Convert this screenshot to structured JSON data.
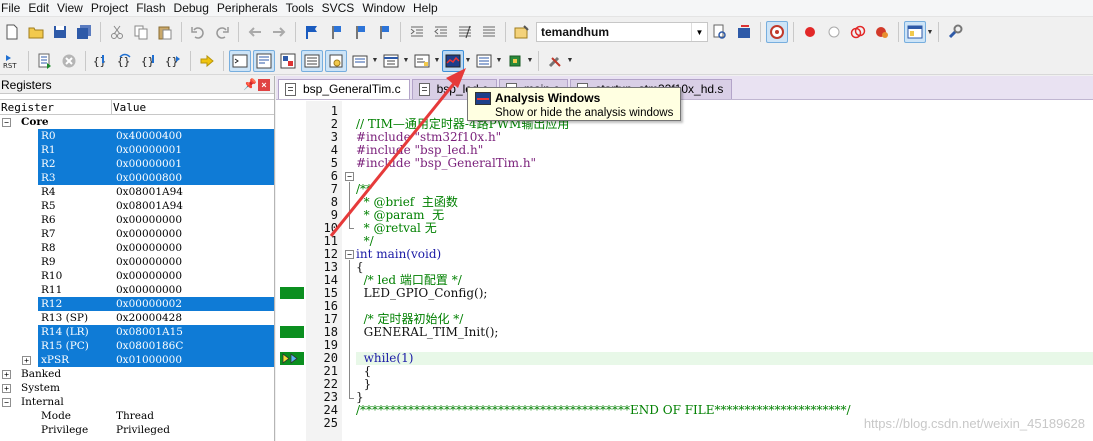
{
  "menu": [
    "File",
    "Edit",
    "View",
    "Project",
    "Flash",
    "Debug",
    "Peripherals",
    "Tools",
    "SVCS",
    "Window",
    "Help"
  ],
  "toolbar": {
    "target_name": "temandhum"
  },
  "registers": {
    "title": "Registers",
    "col_register": "Register",
    "col_value": "Value",
    "core_label": "Core",
    "rows": [
      {
        "name": "R0",
        "value": "0x40000400",
        "selected": true
      },
      {
        "name": "R1",
        "value": "0x00000001",
        "selected": true
      },
      {
        "name": "R2",
        "value": "0x00000001",
        "selected": true
      },
      {
        "name": "R3",
        "value": "0x00000800",
        "selected": true
      },
      {
        "name": "R4",
        "value": "0x08001A94",
        "selected": false
      },
      {
        "name": "R5",
        "value": "0x08001A94",
        "selected": false
      },
      {
        "name": "R6",
        "value": "0x00000000",
        "selected": false
      },
      {
        "name": "R7",
        "value": "0x00000000",
        "selected": false
      },
      {
        "name": "R8",
        "value": "0x00000000",
        "selected": false
      },
      {
        "name": "R9",
        "value": "0x00000000",
        "selected": false
      },
      {
        "name": "R10",
        "value": "0x00000000",
        "selected": false
      },
      {
        "name": "R11",
        "value": "0x00000000",
        "selected": false
      },
      {
        "name": "R12",
        "value": "0x00000002",
        "selected": true
      },
      {
        "name": "R13 (SP)",
        "value": "0x20000428",
        "selected": false
      },
      {
        "name": "R14 (LR)",
        "value": "0x08001A15",
        "selected": true
      },
      {
        "name": "R15 (PC)",
        "value": "0x0800186C",
        "selected": true
      },
      {
        "name": "xPSR",
        "value": "0x01000000",
        "selected": true
      }
    ],
    "groups": [
      "Banked",
      "System",
      "Internal"
    ],
    "internal_rows": [
      {
        "name": "Mode",
        "value": "Thread"
      },
      {
        "name": "Privilege",
        "value": "Privileged"
      }
    ]
  },
  "tabs": [
    {
      "label": "bsp_GeneralTim.c"
    },
    {
      "label": "bsp_led.c"
    },
    {
      "label": "main.c"
    },
    {
      "label": "startup_stm32f10x_hd.s"
    }
  ],
  "tooltip": {
    "title": "Analysis Windows",
    "desc": "Show or hide the analysis windows"
  },
  "code": {
    "line_numbers": [
      "1",
      "2",
      "3",
      "4",
      "5",
      "6",
      "7",
      "8",
      "9",
      "10",
      "11",
      "12",
      "13",
      "14",
      "15",
      "16",
      "17",
      "18",
      "19",
      "20",
      "21",
      "22",
      "23",
      "24",
      "25"
    ],
    "lines": [
      "",
      "// TIM—通用定时器-4路PWM输出应用",
      "#include \"stm32f10x.h\"",
      "#include \"bsp_led.h\"",
      "#include \"bsp_GeneralTim.h\"",
      "",
      "/**",
      "  * @brief  主函数",
      "  * @param  无",
      "  * @retval 无",
      "  */",
      "int main(void)",
      "{",
      "  /* led 端口配置 */",
      "  LED_GPIO_Config();",
      "",
      "  /* 定时器初始化 */",
      "  GENERAL_TIM_Init();",
      "",
      "  while(1)",
      "  {",
      "  }",
      "}",
      "/*********************************************END OF FILE**********************/",
      ""
    ]
  },
  "watermark": "https://blog.csdn.net/weixin_45189628"
}
